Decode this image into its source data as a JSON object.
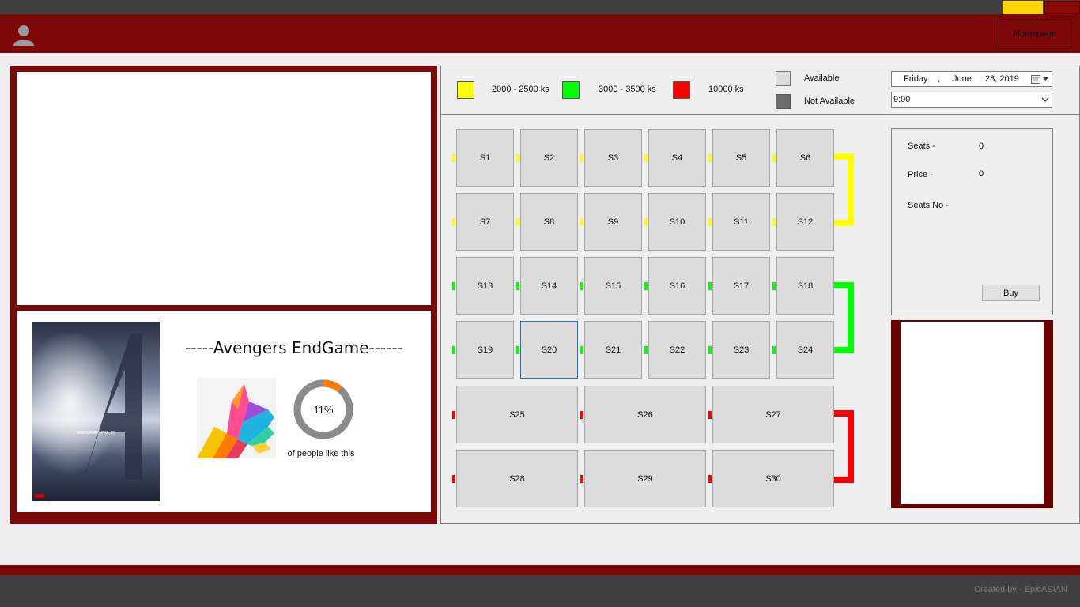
{
  "header": {
    "homepage_label": "Homepage"
  },
  "movie": {
    "title": "-----Avengers EndGame------",
    "like_percent": 11,
    "like_percent_text": "11%",
    "like_caption": "of people like this"
  },
  "poster": {
    "text": "ENDGAME  APRIL 26"
  },
  "legend": {
    "tiers": [
      {
        "label": "2000 - 2500 ks",
        "color": "#ffff00"
      },
      {
        "label": "3000 - 3500 ks",
        "color": "#00ff00"
      },
      {
        "label": "10000 ks",
        "color": "#ff0000"
      }
    ],
    "available": {
      "label": "Available",
      "color": "#dcdcdc"
    },
    "not_available": {
      "label": "Not Available",
      "color": "#6d6d6d"
    }
  },
  "date": {
    "day": "Friday",
    "sep": ",",
    "month": "June",
    "day_year": "28, 2019"
  },
  "time": {
    "value": "9:00"
  },
  "seats": {
    "row1": [
      "S1",
      "S2",
      "S3",
      "S4",
      "S5",
      "S6"
    ],
    "row2": [
      "S7",
      "S8",
      "S9",
      "S10",
      "S11",
      "S12"
    ],
    "row3": [
      "S13",
      "S14",
      "S15",
      "S16",
      "S17",
      "S18"
    ],
    "row4": [
      "S19",
      "S20",
      "S21",
      "S22",
      "S23",
      "S24"
    ],
    "row5": [
      "S25",
      "S26",
      "S27"
    ],
    "row6": [
      "S28",
      "S29",
      "S30"
    ]
  },
  "summary": {
    "seats_label": "Seats -",
    "seats_value": "0",
    "price_label": "Price -",
    "price_value": "0",
    "seatsno_label": "Seats No -",
    "seatsno_value": ""
  },
  "buy_label": "Buy",
  "footer": {
    "credit": "Created by - EpicASIAN"
  }
}
